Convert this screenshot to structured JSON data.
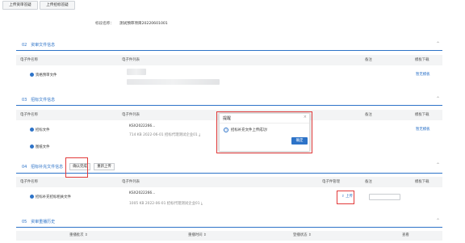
{
  "toolbar": {
    "upload_bid_label": "上传资审答疑",
    "upload_tender_label": "上传招标答疑"
  },
  "project": {
    "name_label": "标段名称：",
    "name_value": "测试预审项目20220601001"
  },
  "sections": {
    "s02": {
      "num": "02",
      "title": "资审文件信息"
    },
    "s03": {
      "num": "03",
      "title": "招标文件信息"
    },
    "s04": {
      "num": "04",
      "title": "招标补充文件信息",
      "confirm_label": "确认完成",
      "reupload_label": "重新上传"
    },
    "s05": {
      "num": "05",
      "title": "资审重播历史"
    }
  },
  "headers": {
    "file_name": "电子件名称",
    "file_list": "电子件列表",
    "file_manage": "电子件管理",
    "remark": "备注",
    "template_download": "模板下载"
  },
  "rows": {
    "prequal": {
      "name": "资格预审文件",
      "template": "暂无模板"
    },
    "tender": {
      "name": "招标文件",
      "list_code": "KSX2022266...",
      "list_meta": "714 KB 2022-06-01 招标代理测试企业01",
      "template": "暂无模板"
    },
    "drawings": {
      "name": "图纸文件"
    },
    "supp": {
      "name": "招标补充招标相关文件",
      "list_code": "KSX2022266...",
      "list_meta": "1005 KB 2022-06-01 招标代理测试企业01",
      "upload_label": "上传"
    }
  },
  "modal": {
    "title": "提醒",
    "message": "招标补充文件上传成功!",
    "ok_label": "确定"
  },
  "history": {
    "cols": [
      "重播批次 ⇕",
      "重播时间 ⇕",
      "登播状态 ⇕",
      "查看"
    ]
  },
  "colors": {
    "accent": "#2d73c8",
    "highlight": "#e23b3b"
  }
}
